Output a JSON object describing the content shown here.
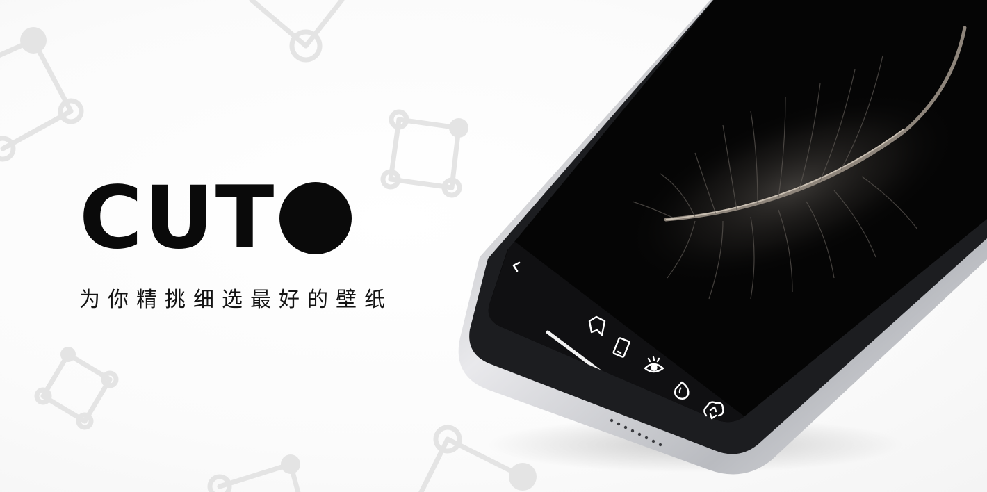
{
  "brand": {
    "logo_text": "CUT",
    "tagline": "为你精挑细选最好的壁纸"
  },
  "colors": {
    "background": "#ffffff",
    "decor": "#e4e4e4",
    "brand_black": "#0a0a0a",
    "phone_frame": "#1c1d20",
    "phone_rim": "#c9c9cc",
    "screen": "#050505",
    "toolbar": "#121214",
    "icon": "#ffffff"
  },
  "phone": {
    "wallpaper": "feather",
    "toolbar_icons": [
      "back-chevron-icon",
      "bookmark-icon",
      "phone-preview-icon",
      "eye-icon",
      "drop-icon",
      "cloud-sync-icon"
    ]
  }
}
